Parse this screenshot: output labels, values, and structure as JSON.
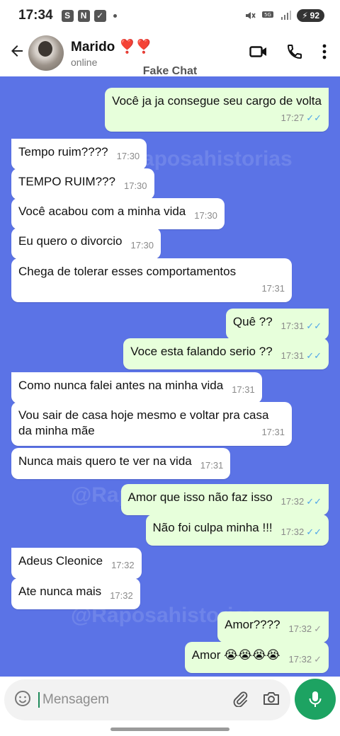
{
  "status_bar": {
    "time": "17:34",
    "icons": [
      "S",
      "N"
    ],
    "battery": "92"
  },
  "header": {
    "contact_name": "Marido ❣️❣️",
    "contact_status": "online",
    "overlay_title": "Fake Chat"
  },
  "watermark": "@Raposahistorias",
  "messages": [
    {
      "dir": "out",
      "text": "Você ja ja consegue seu cargo de volta",
      "time": "17:27",
      "tick": "read"
    },
    {
      "dir": "in",
      "text": "Tempo ruim????",
      "time": "17:30"
    },
    {
      "dir": "in",
      "text": "TEMPO RUIM???",
      "time": "17:30"
    },
    {
      "dir": "in",
      "text": "Você acabou com a minha vida",
      "time": "17:30"
    },
    {
      "dir": "in",
      "text": "Eu quero o divorcio",
      "time": "17:30"
    },
    {
      "dir": "in",
      "text": "Chega de tolerar esses comportamentos",
      "time": "17:31"
    },
    {
      "dir": "out",
      "text": "Quê ??",
      "time": "17:31",
      "tick": "read"
    },
    {
      "dir": "out",
      "text": "Voce esta falando serio ??",
      "time": "17:31",
      "tick": "read"
    },
    {
      "dir": "in",
      "text": "Como nunca falei antes na minha vida",
      "time": "17:31"
    },
    {
      "dir": "in",
      "text": "Vou sair de casa hoje mesmo e voltar pra casa da minha mãe",
      "time": "17:31"
    },
    {
      "dir": "in",
      "text": "Nunca mais quero te ver na vida",
      "time": "17:31"
    },
    {
      "dir": "out",
      "text": "Amor que isso não faz isso",
      "time": "17:32",
      "tick": "read"
    },
    {
      "dir": "out",
      "text": "Não foi culpa minha !!!",
      "time": "17:32",
      "tick": "read"
    },
    {
      "dir": "in",
      "text": "Adeus Cleonice",
      "time": "17:32"
    },
    {
      "dir": "in",
      "text": "Ate nunca mais",
      "time": "17:32"
    },
    {
      "dir": "out",
      "text": "Amor????",
      "time": "17:32",
      "tick": "sent"
    },
    {
      "dir": "out",
      "text": "Amor 😭😭😭😭",
      "time": "17:32",
      "tick": "sent"
    }
  ],
  "composer": {
    "placeholder": "Mensagem"
  },
  "icons": [
    "back-arrow-icon",
    "video-call-icon",
    "phone-icon",
    "more-options-icon",
    "emoji-icon",
    "attach-icon",
    "camera-icon",
    "mic-icon"
  ],
  "colors": {
    "chat_background": "#5b73e6",
    "outgoing_bubble": "#e7ffdb",
    "incoming_bubble": "#ffffff",
    "read_tick": "#4fa6e8",
    "mic_button": "#1da362"
  }
}
